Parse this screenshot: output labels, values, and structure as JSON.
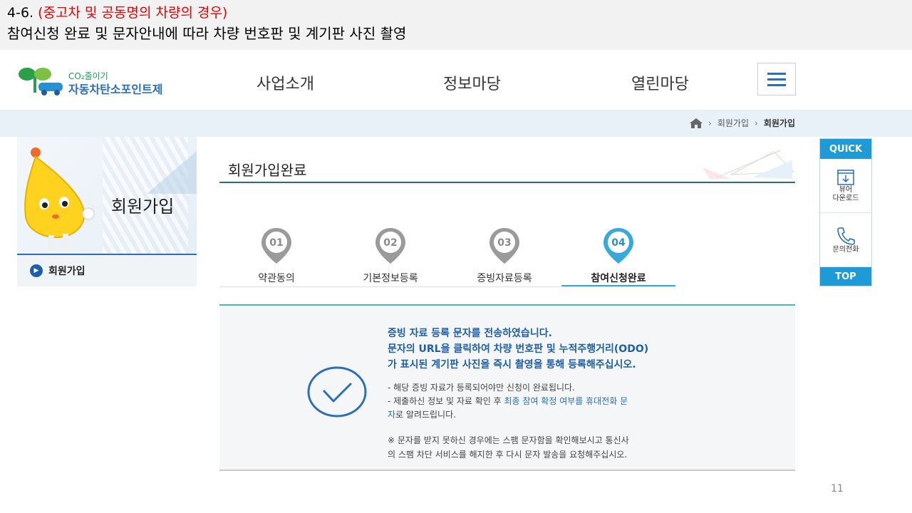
{
  "slide": {
    "heading_prefix": "4-6. ",
    "heading_red": "(중고차 및 공동명의 차량의 경우)",
    "subheading": "참여신청 완료 및 문자안내에 따라 차량 번호판 및 계기판 사진 촬영",
    "page_number": "11"
  },
  "site": {
    "logo_small": "CO₂줄이기",
    "logo_big": "자동차탄소포인트제",
    "menu": [
      "사업소개",
      "정보마당",
      "열린마당"
    ]
  },
  "breadcrumb": {
    "items": [
      "회원가입",
      "회원가입"
    ]
  },
  "left": {
    "banner_title": "회원가입",
    "nav_item": "회원가입"
  },
  "main": {
    "title": "회원가입완료",
    "steps": [
      {
        "num": "01",
        "label": "약관동의",
        "active": false
      },
      {
        "num": "02",
        "label": "기본정보등록",
        "active": false
      },
      {
        "num": "03",
        "label": "증빙자료등록",
        "active": false
      },
      {
        "num": "04",
        "label": "참여신청완료",
        "active": true
      }
    ],
    "message_line1": "증빙 자료 등록 문자를 전송하였습니다.",
    "message_line2": "문자의 URL을 클릭하여 차량 번호판 및 누적주행거리(ODO)",
    "message_line3": "가 표시된 계기판 사진을 즉시 촬영을 통해 등록해주십시오.",
    "bullet1": "- 해당 증빙 자료가 등록되어야만 신청이 완료됩니다.",
    "bullet2_pre": "- 제출하신 정보 및 자료 확인 후 ",
    "bullet2_hl": "최종 참여 확정 여부를 휴대전화 문",
    "bullet2_hl2": "자",
    "bullet2_post": "로 알려드립니다.",
    "notice_line1": "※ 문자를 받지 못하신 경우에는 스팸 문자함을 확인해보시고 통신사",
    "notice_line2": "의 스팸 차단 서비스를 해지한 후 다시 문자 발송을 요청해주십시오."
  },
  "quick": {
    "head": "QUICK",
    "viewer_line1": "뷰어",
    "viewer_line2": "다운로드",
    "call": "문의전화",
    "top": "TOP"
  },
  "colors": {
    "accent": "#1e9bd7",
    "brand_blue": "#2a6fb8",
    "step_active": "#39a9dc",
    "step_inactive": "#9a9a9a"
  }
}
